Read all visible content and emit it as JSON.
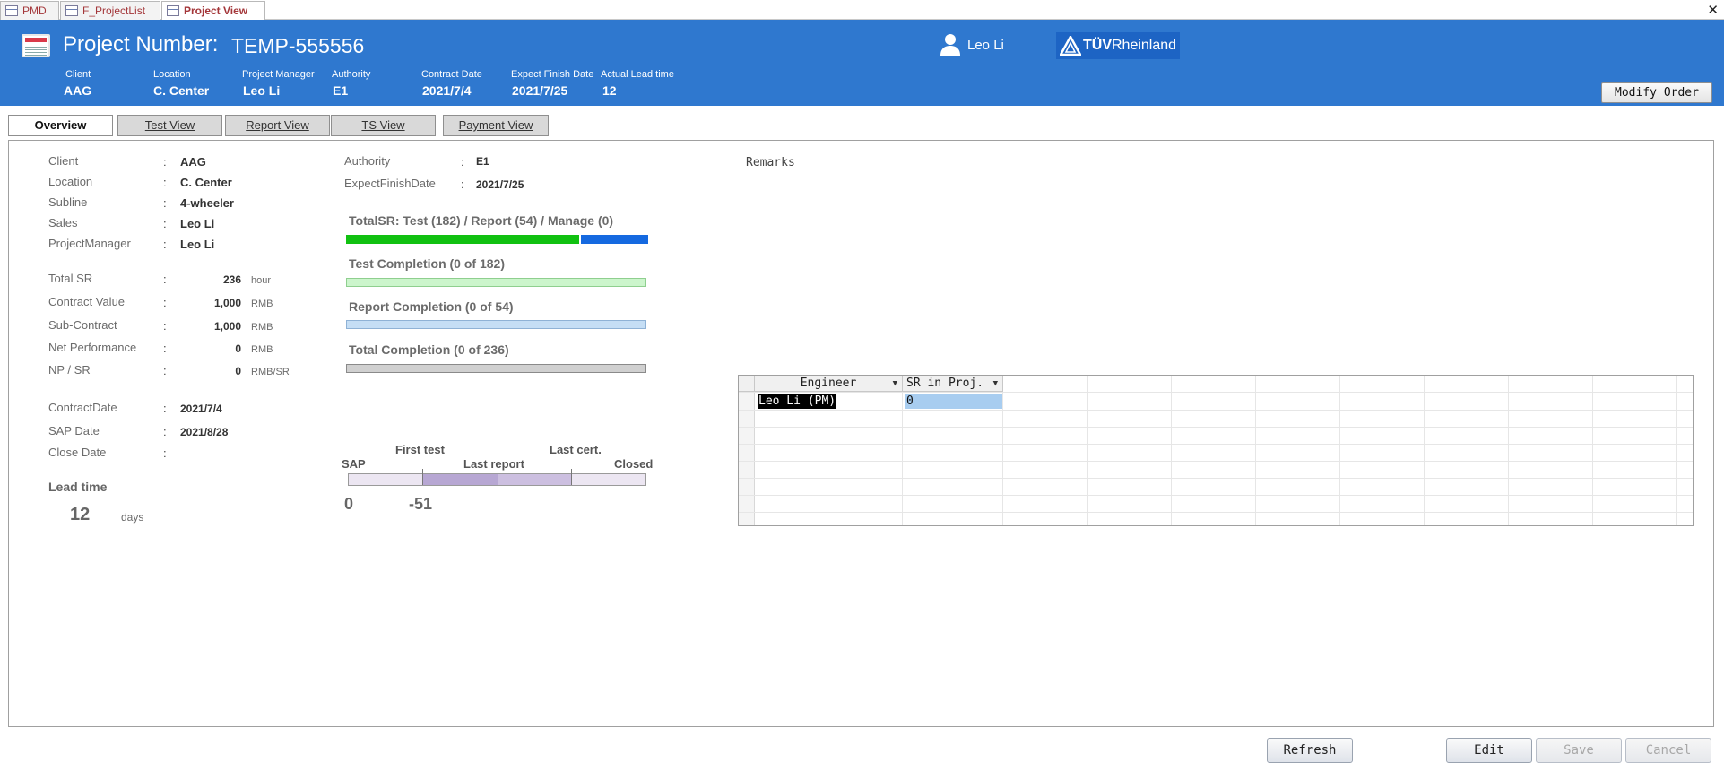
{
  "doc_tabs": [
    "PMD",
    "F_ProjectList",
    "Project View"
  ],
  "header": {
    "project_number_label": "Project Number:",
    "project_number": "TEMP-555556",
    "user_name": "Leo Li",
    "logo_text_a": "TÜV",
    "logo_text_b": "Rheinland",
    "info": [
      {
        "label": "Client",
        "value": "AAG"
      },
      {
        "label": "Location",
        "value": "C. Center"
      },
      {
        "label": "Project Manager",
        "value": "Leo Li"
      },
      {
        "label": "Authority",
        "value": "E1"
      },
      {
        "label": "Contract Date",
        "value": "2021/7/4"
      },
      {
        "label": "Expect Finish Date",
        "value": "2021/7/25"
      },
      {
        "label": "Actual Lead time",
        "value": "12"
      }
    ],
    "modify_button": "Modify Order"
  },
  "view_tabs": [
    "Overview",
    "Test View",
    "Report View",
    "TS View",
    "Payment View"
  ],
  "overview": {
    "details": [
      {
        "label": "Client",
        "value": "AAG"
      },
      {
        "label": "Location",
        "value": "C. Center"
      },
      {
        "label": "Subline",
        "value": "4-wheeler"
      },
      {
        "label": "Sales",
        "value": "Leo Li"
      },
      {
        "label": "ProjectManager",
        "value": "Leo Li"
      }
    ],
    "figures": [
      {
        "label": "Total SR",
        "value": "236",
        "unit": "hour"
      },
      {
        "label": "Contract Value",
        "value": "1,000",
        "unit": "RMB"
      },
      {
        "label": "Sub-Contract",
        "value": "1,000",
        "unit": "RMB"
      },
      {
        "label": "Net Performance",
        "value": "0",
        "unit": "RMB"
      },
      {
        "label": "NP / SR",
        "value": "0",
        "unit": "RMB/SR"
      }
    ],
    "dates": [
      {
        "label": "ContractDate",
        "value": "2021/7/4"
      },
      {
        "label": "SAP Date",
        "value": "2021/8/28"
      },
      {
        "label": "Close Date",
        "value": ""
      }
    ],
    "lead_time_label": "Lead time",
    "lead_time_value": "12",
    "lead_time_unit": "days",
    "authority_label": "Authority",
    "authority_value": "E1",
    "expect_finish_label": "ExpectFinishDate",
    "expect_finish_value": "2021/7/25",
    "colon": ":"
  },
  "progress": {
    "total_sr_title": "TotalSR: Test (182) / Report (54) / Manage (0)",
    "test": 182,
    "report": 54,
    "manage": 0,
    "test_completion_title": "Test Completion (0 of 182)",
    "test_completion": 0,
    "report_completion_title": "Report Completion (0 of 54)",
    "report_completion": 0,
    "total_completion_title": "Total Completion (0 of 236)",
    "total_completion": 0,
    "colors": {
      "test": "#11c111",
      "report": "#1569e0",
      "test_bg": "#ccf5cc",
      "report_bg": "#c5def5",
      "total_bg": "#d0d0d0"
    }
  },
  "timeline": {
    "sap": "SAP",
    "first_test": "First test",
    "last_report": "Last report",
    "last_cert": "Last cert.",
    "closed": "Closed",
    "value_a": "0",
    "value_b": "-51"
  },
  "remarks_label": "Remarks",
  "engineers": {
    "columns": [
      "Engineer",
      "SR in Proj."
    ],
    "rows": [
      [
        "Leo Li (PM)",
        "0"
      ]
    ]
  },
  "buttons": {
    "refresh": "Refresh",
    "edit": "Edit",
    "save": "Save",
    "cancel": "Cancel"
  }
}
